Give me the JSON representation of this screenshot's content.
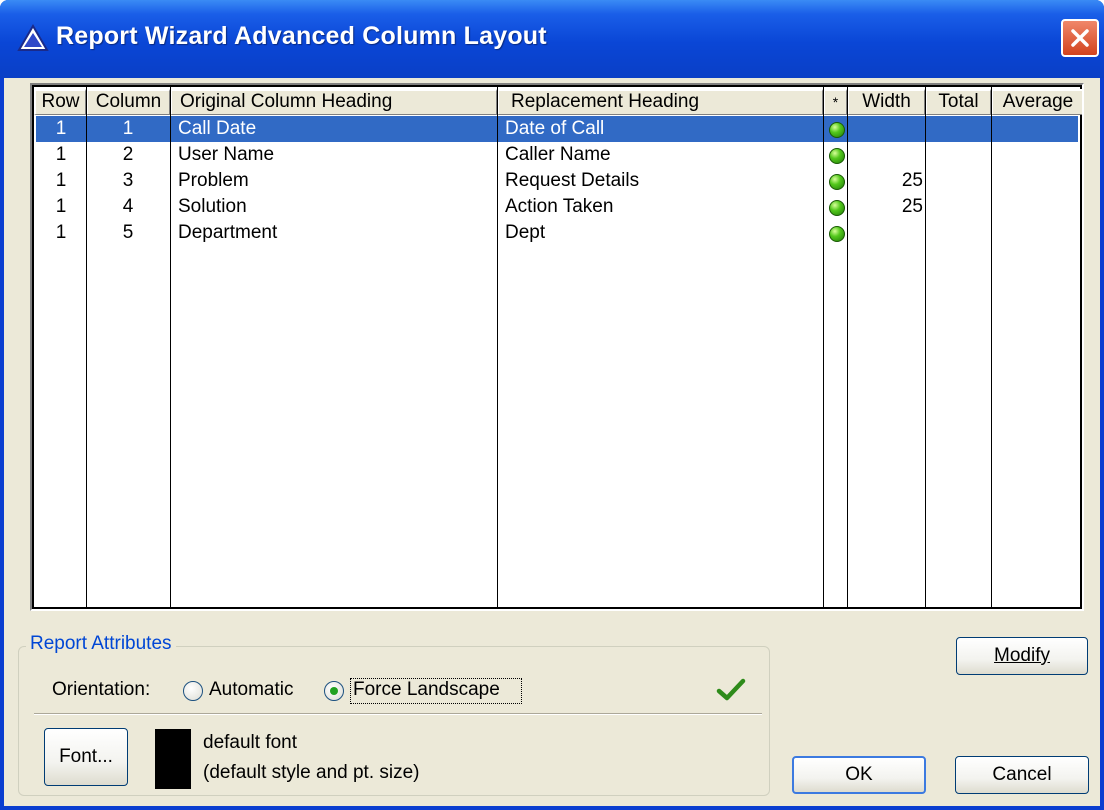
{
  "window": {
    "title": "Report Wizard Advanced Column Layout"
  },
  "grid": {
    "headers": [
      "Row",
      "Column",
      "Original Column Heading",
      "Replacement Heading",
      "*",
      "Width",
      "Total",
      "Average"
    ],
    "rows": [
      {
        "row": "1",
        "column": "1",
        "original": "Call Date",
        "replacement": "Date of Call",
        "width": "",
        "selected": true
      },
      {
        "row": "1",
        "column": "2",
        "original": "User Name",
        "replacement": "Caller Name",
        "width": ""
      },
      {
        "row": "1",
        "column": "3",
        "original": "Problem",
        "replacement": "Request Details",
        "width": "25"
      },
      {
        "row": "1",
        "column": "4",
        "original": "Solution",
        "replacement": "Action Taken",
        "width": "25"
      },
      {
        "row": "1",
        "column": "5",
        "original": "Department",
        "replacement": "Dept",
        "width": ""
      }
    ]
  },
  "attributes": {
    "group_title": "Report Attributes",
    "orientation_label": "Orientation:",
    "automatic_label": "Automatic",
    "landscape_label": "Force Landscape",
    "selected_orientation": "Force Landscape",
    "font_button": "Font...",
    "font_line1": "default font",
    "font_line2": "(default style and pt. size)",
    "font_color": "#000000"
  },
  "buttons": {
    "modify": "Modify",
    "ok": "OK",
    "cancel": "Cancel"
  },
  "colors": {
    "title_bar": "#0a46d6",
    "selection": "#316ac5",
    "dialog_bg": "#ece9d8",
    "status_green": "#53c81c"
  }
}
